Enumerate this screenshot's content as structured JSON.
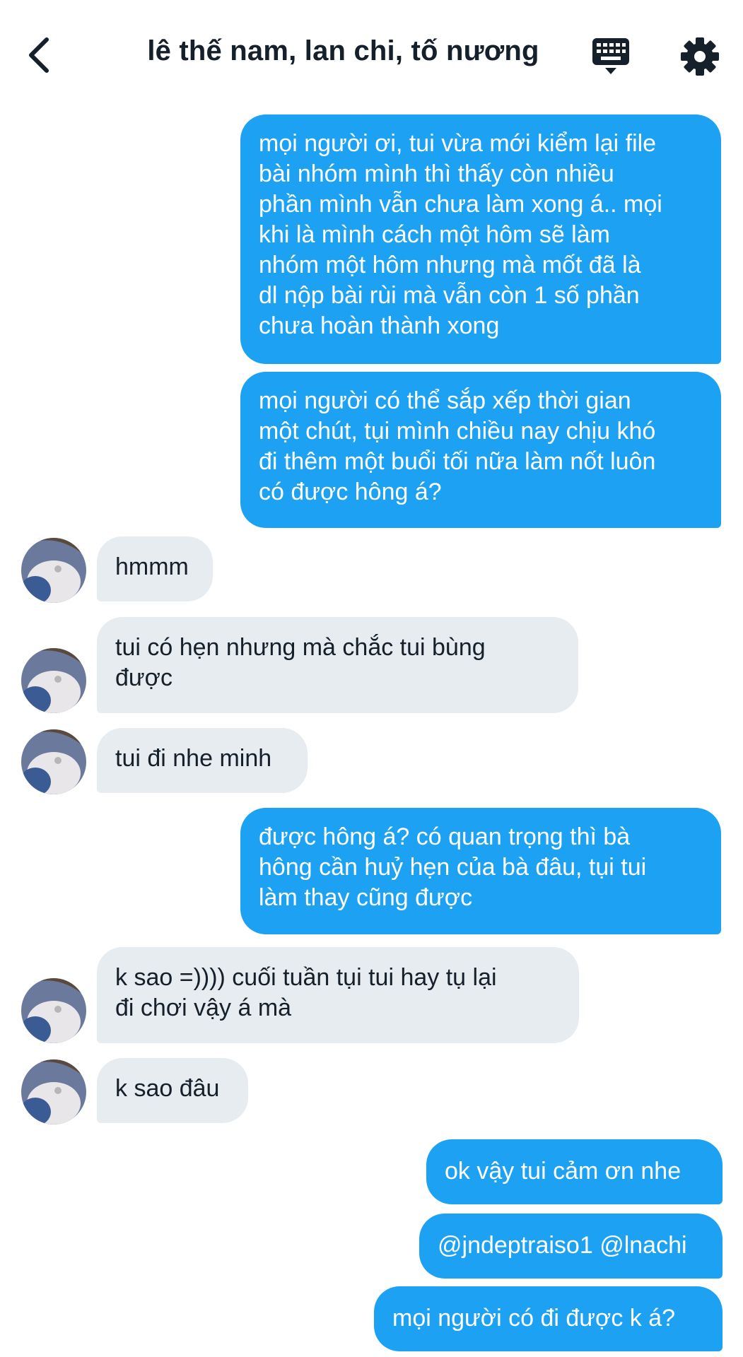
{
  "header": {
    "title": "lê thế nam, lan chi, tố nương",
    "back_icon": "chevron-left-icon",
    "keyboard_icon": "keyboard-icon",
    "settings_icon": "gear-icon"
  },
  "colors": {
    "sent_bubble": "#1da1f2",
    "received_bubble": "#e6ecf0",
    "text_dark": "#15202b"
  },
  "messages": [
    {
      "side": "sent",
      "text": "mọi người ơi, tui vừa mới kiểm lại file\nbài nhóm mình thì thấy còn nhiều\nphần mình vẫn chưa làm xong á.. mọi\nkhi là mình cách một hôm sẽ làm\nnhóm một hôm nhưng mà mốt đã là\ndl nộp bài rùi mà vẫn còn 1 số phần\nchưa hoàn thành xong"
    },
    {
      "side": "sent",
      "text": "mọi người có thể sắp xếp thời gian\nmột chút, tụi mình chiều nay chịu khó\nđi thêm một buổi tối nữa làm nốt luôn\ncó được hông á?"
    },
    {
      "side": "received",
      "text": "hmmm"
    },
    {
      "side": "received",
      "text": "tui có hẹn nhưng mà chắc tui bùng\nđược"
    },
    {
      "side": "received",
      "text": "tui đi nhe minh"
    },
    {
      "side": "sent",
      "text": "được hông á? có quan trọng thì bà\nhông cần huỷ hẹn của bà đâu, tụi tui\nlàm thay cũng được"
    },
    {
      "side": "received",
      "text": "k sao =)))) cuối tuần tụi tui hay tụ lại\nđi chơi vậy á mà"
    },
    {
      "side": "received",
      "text": "k sao đâu"
    },
    {
      "side": "sent",
      "text": "ok vậy tui cảm ơn nhe"
    },
    {
      "side": "sent",
      "text": "@jndeptraiso1 @lnachi"
    },
    {
      "side": "sent",
      "text": "mọi người có đi được k á?"
    }
  ]
}
